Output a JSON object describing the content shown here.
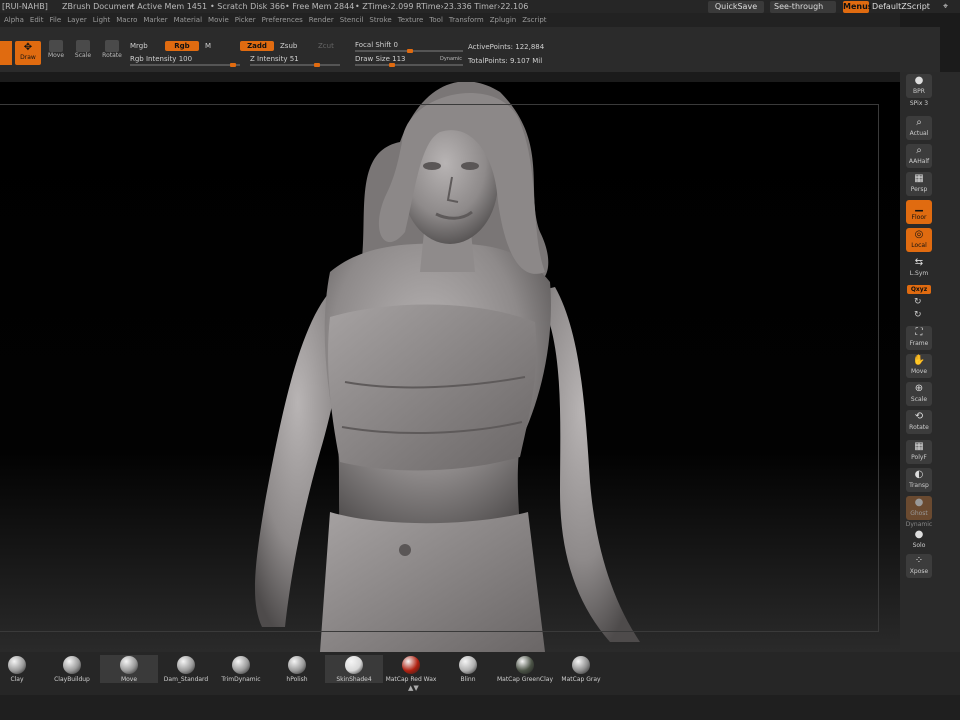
{
  "title_bar": {
    "left_tag": "[RUI-NAHB]",
    "doc": "ZBrush Document",
    "active_mem": "• Active Mem 1451",
    "scratch": "• Scratch Disk 366",
    "free_mem": "• Free Mem 2844",
    "ztime": "• ZTime›2.099 RTime›23.336 Timer›22.106",
    "quicksave": "QuickSave",
    "seethrough": "See-through",
    "seethrough_value": "0",
    "menus": "Menus",
    "default_script": "DefaultZScript"
  },
  "menu": [
    "Alpha",
    "Edit",
    "File",
    "Layer",
    "Light",
    "Macro",
    "Marker",
    "Material",
    "Movie",
    "Picker",
    "Preferences",
    "Render",
    "Stencil",
    "Stroke",
    "Texture",
    "Tool",
    "Transform",
    "Zplugin",
    "Zscript"
  ],
  "shelf": {
    "draw": "Draw",
    "move": "Move",
    "scale": "Scale",
    "rotate": "Rotate",
    "mrgb": "Mrgb",
    "rgb": "Rgb",
    "m": "M",
    "rgb_intensity_label": "Rgb Intensity",
    "rgb_intensity_value": "100",
    "zadd": "Zadd",
    "zsub": "Zsub",
    "zcut": "Zcut",
    "z_intensity_label": "Z Intensity",
    "z_intensity_value": "51",
    "focal_label": "Focal Shift",
    "focal_value": "0",
    "drawsize_label": "Draw Size",
    "drawsize_value": "113",
    "dynamic": "Dynamic",
    "active_points": "ActivePoints: 122,884",
    "total_points": "TotalPoints: 9.107 Mil"
  },
  "right_shelf": {
    "bpr": "BPR",
    "spix": "SPix 3",
    "actual": "Actual",
    "aahalf": "AAHalf",
    "persp": "Persp",
    "floor": "Floor",
    "local": "Local",
    "lsym": "L.Sym",
    "xyz": "Qxyz",
    "frame": "Frame",
    "move": "Move",
    "scale": "Scale",
    "rotate": "Rotate",
    "polyf": "PolyF",
    "transp": "Transp",
    "ghost": "Ghost",
    "dynamic": "Dynamic",
    "solo": "Solo",
    "xpose": "Xpose"
  },
  "tray": [
    {
      "label": "Clay",
      "color": "#9a9a9a"
    },
    {
      "label": "ClayBuildup",
      "color": "#9a9a9a"
    },
    {
      "label": "Move",
      "color": "#9a9a9a"
    },
    {
      "label": "Dam_Standard",
      "color": "#9a9a9a"
    },
    {
      "label": "TrimDynamic",
      "color": "#9a9a9a"
    },
    {
      "label": "hPolish",
      "color": "#9a9a9a"
    },
    {
      "label": "SkinShade4",
      "color": "#d8d8d8"
    },
    {
      "label": "MatCap Red Wax",
      "color": "#b02010"
    },
    {
      "label": "Blinn",
      "color": "#b0b0b0"
    },
    {
      "label": "MatCap GreenClay",
      "color": "#4a5245"
    },
    {
      "label": "MatCap Gray",
      "color": "#8e8e8e"
    }
  ],
  "colors": {
    "accent": "#e06b10",
    "panel": "#2a2a2a",
    "viewport": "#000000"
  }
}
